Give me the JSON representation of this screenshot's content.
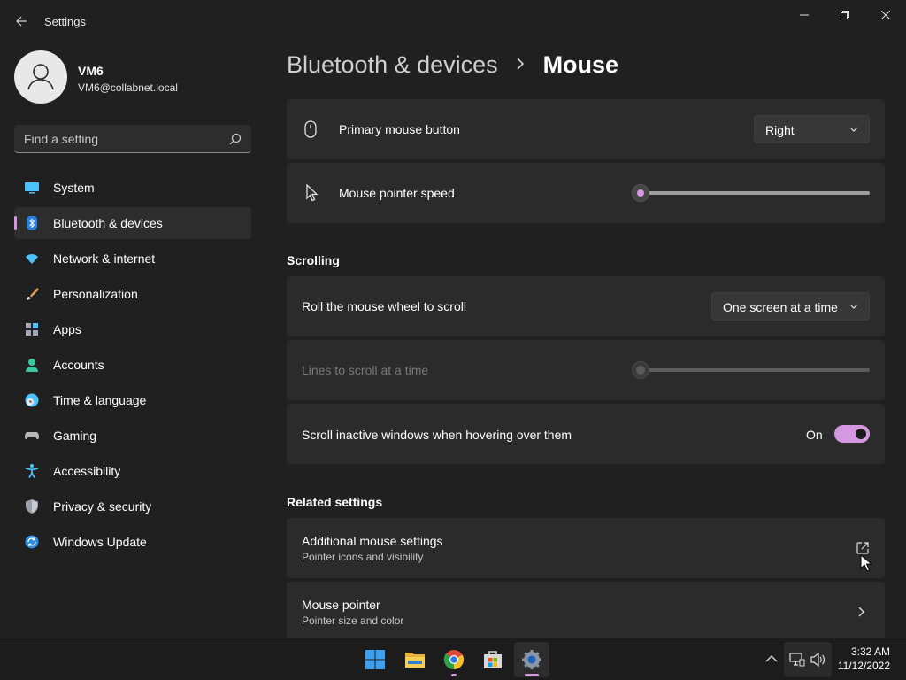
{
  "window": {
    "title": "Settings",
    "back_icon": "back-arrow-icon",
    "minimize_icon": "minimize-icon",
    "maximize_icon": "restore-icon",
    "close_icon": "close-icon"
  },
  "profile": {
    "name": "VM6",
    "email": "VM6@collabnet.local",
    "avatar_icon": "user-avatar-icon"
  },
  "search": {
    "placeholder": "Find a setting",
    "icon": "search-icon"
  },
  "sidebar": {
    "items": [
      {
        "label": "System",
        "icon": "monitor-icon",
        "active": false
      },
      {
        "label": "Bluetooth & devices",
        "icon": "bluetooth-icon",
        "active": true
      },
      {
        "label": "Network & internet",
        "icon": "wifi-icon",
        "active": false
      },
      {
        "label": "Personalization",
        "icon": "paintbrush-icon",
        "active": false
      },
      {
        "label": "Apps",
        "icon": "apps-icon",
        "active": false
      },
      {
        "label": "Accounts",
        "icon": "person-icon",
        "active": false
      },
      {
        "label": "Time & language",
        "icon": "clock-globe-icon",
        "active": false
      },
      {
        "label": "Gaming",
        "icon": "gamepad-icon",
        "active": false
      },
      {
        "label": "Accessibility",
        "icon": "accessibility-icon",
        "active": false
      },
      {
        "label": "Privacy & security",
        "icon": "shield-icon",
        "active": false
      },
      {
        "label": "Windows Update",
        "icon": "update-icon",
        "active": false
      }
    ]
  },
  "breadcrumb": {
    "parent": "Bluetooth & devices",
    "separator_icon": "chevron-right-icon",
    "current": "Mouse"
  },
  "settings": {
    "primary_button": {
      "label": "Primary mouse button",
      "icon": "mouse-icon",
      "value": "Right"
    },
    "pointer_speed": {
      "label": "Mouse pointer speed",
      "icon": "pointer-icon",
      "value_fraction": 0.0
    }
  },
  "scrolling": {
    "title": "Scrolling",
    "roll_wheel": {
      "label": "Roll the mouse wheel to scroll",
      "value": "One screen at a time"
    },
    "lines": {
      "label": "Lines to scroll at a time",
      "disabled": true,
      "value_fraction": 0.0
    },
    "inactive": {
      "label": "Scroll inactive windows when hovering over them",
      "state": "On",
      "on": true
    }
  },
  "related": {
    "title": "Related settings",
    "additional": {
      "label": "Additional mouse settings",
      "sub": "Pointer icons and visibility",
      "icon": "open-external-icon"
    },
    "pointer": {
      "label": "Mouse pointer",
      "sub": "Pointer size and color",
      "icon": "chevron-right-icon"
    }
  },
  "taskbar": {
    "apps": [
      {
        "name": "start",
        "icon": "windows-start-icon"
      },
      {
        "name": "file-explorer",
        "icon": "folder-icon"
      },
      {
        "name": "chrome",
        "icon": "chrome-icon"
      },
      {
        "name": "store",
        "icon": "store-icon"
      },
      {
        "name": "settings",
        "icon": "gear-icon",
        "active": true
      }
    ],
    "tray_icons": [
      "chevron-up-icon",
      "network-icon",
      "volume-icon"
    ],
    "time": "3:32 AM",
    "date": "11/12/2022"
  },
  "colors": {
    "accent": "#d497e0",
    "background": "#202020",
    "card": "#2b2b2b"
  }
}
